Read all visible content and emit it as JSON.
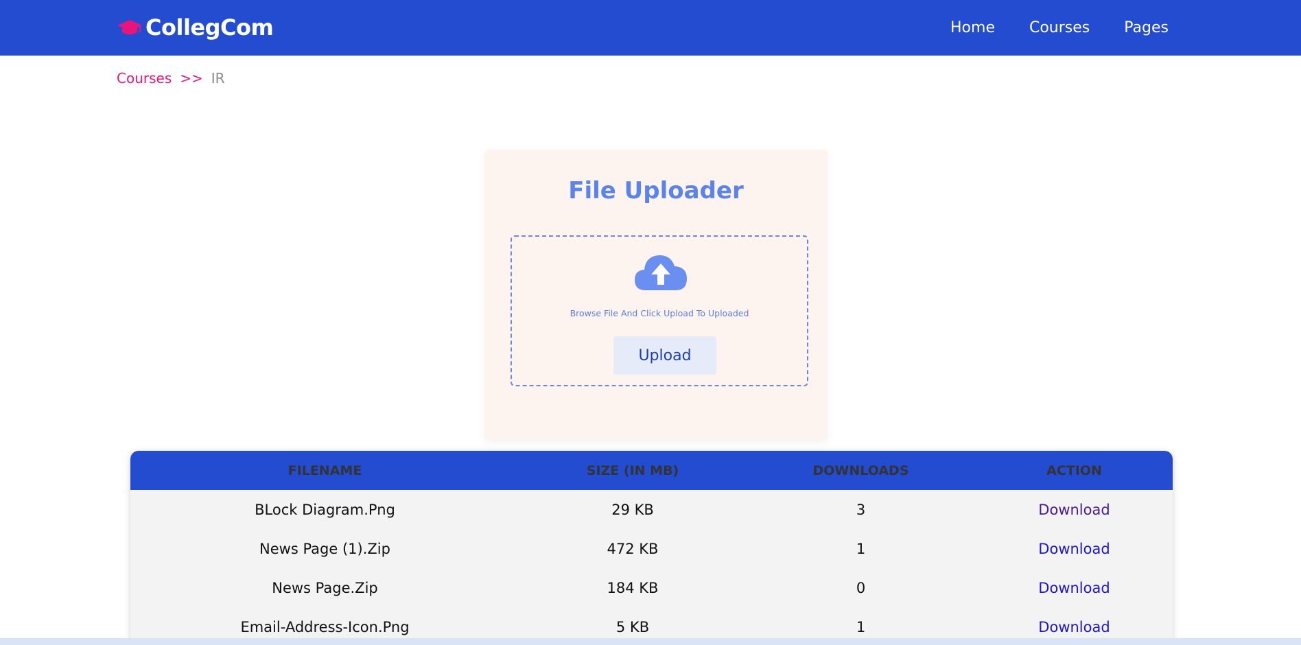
{
  "brand": {
    "name": "CollegCom",
    "icon": "graduation-cap-icon",
    "icon_color": "#e8157b"
  },
  "nav": {
    "items": [
      "Home",
      "Courses",
      "Pages"
    ]
  },
  "breadcrumb": {
    "link": "Courses",
    "separator": ">>",
    "current": "IR"
  },
  "uploader": {
    "title": "File Uploader",
    "icon": "cloud-upload-icon",
    "hint": "Browse File And Click Upload To Uploaded",
    "button_label": "Upload"
  },
  "table": {
    "headers": [
      "FILENAME",
      "SIZE (IN MB)",
      "DOWNLOADS",
      "ACTION"
    ],
    "rows": [
      {
        "filename": "BLock Diagram.Png",
        "size": "29 KB",
        "downloads": "3",
        "action": "Download"
      },
      {
        "filename": "News Page (1).Zip",
        "size": "472 KB",
        "downloads": "1",
        "action": "Download"
      },
      {
        "filename": "News Page.Zip",
        "size": "184 KB",
        "downloads": "0",
        "action": "Download"
      },
      {
        "filename": "Email-Address-Icon.Png",
        "size": "5 KB",
        "downloads": "1",
        "action": "Download"
      }
    ]
  },
  "colors": {
    "navbar": "#234cd0",
    "accent_pink": "#e8157b",
    "title_blue": "#5b83ec",
    "card_bg": "#fdf3ef",
    "link_blue": "#1e15d4"
  }
}
